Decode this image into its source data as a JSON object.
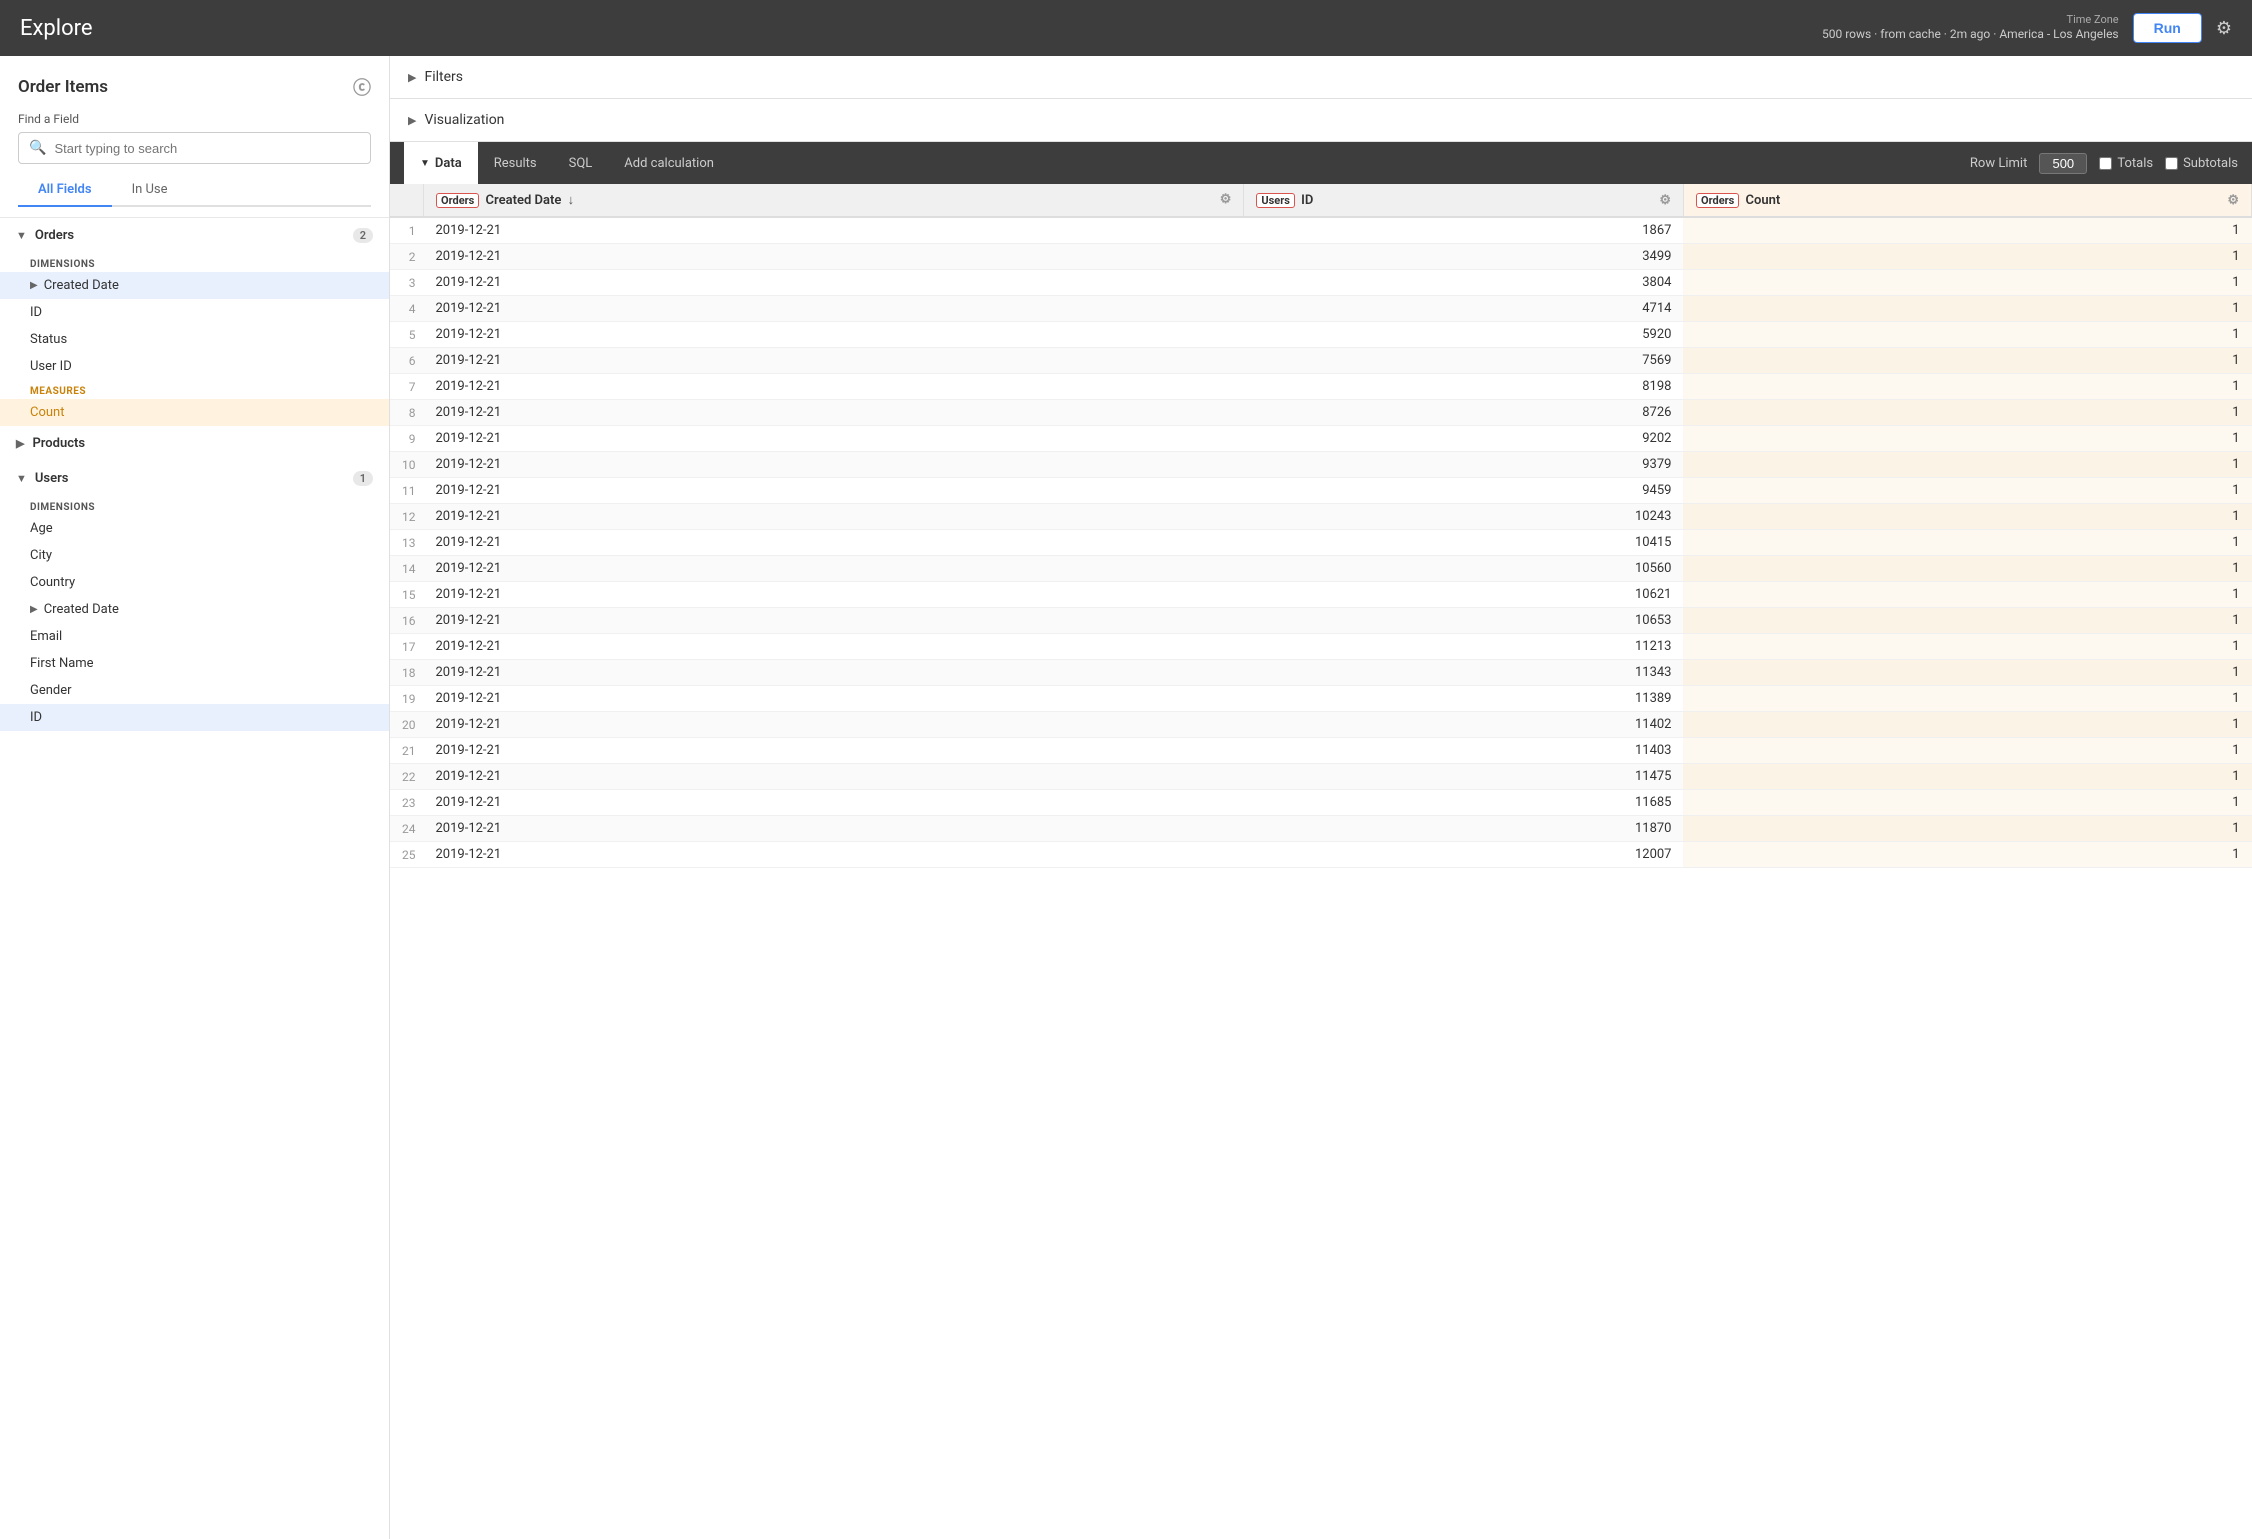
{
  "app": {
    "title": "Explore"
  },
  "topnav": {
    "info_rows": "500 rows · from cache · 2m ago · America - Los Angeles",
    "timezone_label": "Time Zone",
    "run_button": "Run"
  },
  "sidebar": {
    "title": "Order Items",
    "find_field_label": "Find a Field",
    "search_placeholder": "Start typing to search",
    "tabs": [
      {
        "label": "All Fields",
        "active": true
      },
      {
        "label": "In Use",
        "active": false
      }
    ],
    "groups": [
      {
        "name": "Orders",
        "expanded": true,
        "count": 2,
        "sections": [
          {
            "type": "DIMENSIONS",
            "fields": [
              {
                "label": "Created Date",
                "selected": true,
                "hasArrow": true
              },
              {
                "label": "ID",
                "selected": false
              },
              {
                "label": "Status",
                "selected": false
              },
              {
                "label": "User ID",
                "selected": false
              }
            ]
          },
          {
            "type": "MEASURES",
            "fields": [
              {
                "label": "Count",
                "selected": true,
                "measure": true
              }
            ]
          }
        ]
      },
      {
        "name": "Products",
        "expanded": false,
        "count": null,
        "sections": []
      },
      {
        "name": "Users",
        "expanded": true,
        "count": 1,
        "sections": [
          {
            "type": "DIMENSIONS",
            "fields": [
              {
                "label": "Age",
                "selected": false
              },
              {
                "label": "City",
                "selected": false
              },
              {
                "label": "Country",
                "selected": false
              },
              {
                "label": "Created Date",
                "selected": false,
                "hasArrow": true
              },
              {
                "label": "Email",
                "selected": false
              },
              {
                "label": "First Name",
                "selected": false
              },
              {
                "label": "Gender",
                "selected": false
              },
              {
                "label": "ID",
                "selected": true
              }
            ]
          }
        ]
      }
    ]
  },
  "filters": {
    "label": "Filters"
  },
  "visualization": {
    "label": "Visualization"
  },
  "toolbar": {
    "tabs": [
      {
        "label": "Data",
        "active": true,
        "hasArrow": true
      },
      {
        "label": "Results",
        "active": false
      },
      {
        "label": "SQL",
        "active": false
      },
      {
        "label": "Add calculation",
        "active": false
      }
    ],
    "row_limit_label": "Row Limit",
    "row_limit_value": "500",
    "totals_label": "Totals",
    "subtotals_label": "Subtotals"
  },
  "table": {
    "columns": [
      {
        "badge": "Orders",
        "label": "Created Date",
        "sort": "↓",
        "gear": true,
        "type": "dimension"
      },
      {
        "badge": "Users",
        "label": "ID",
        "sort": "",
        "gear": true,
        "type": "dimension"
      },
      {
        "badge": "Orders",
        "label": "Count",
        "sort": "",
        "gear": true,
        "type": "measure"
      }
    ],
    "rows": [
      {
        "num": 1,
        "date": "2019-12-21",
        "user_id": "1867",
        "count": "1"
      },
      {
        "num": 2,
        "date": "2019-12-21",
        "user_id": "3499",
        "count": "1"
      },
      {
        "num": 3,
        "date": "2019-12-21",
        "user_id": "3804",
        "count": "1"
      },
      {
        "num": 4,
        "date": "2019-12-21",
        "user_id": "4714",
        "count": "1"
      },
      {
        "num": 5,
        "date": "2019-12-21",
        "user_id": "5920",
        "count": "1"
      },
      {
        "num": 6,
        "date": "2019-12-21",
        "user_id": "7569",
        "count": "1"
      },
      {
        "num": 7,
        "date": "2019-12-21",
        "user_id": "8198",
        "count": "1"
      },
      {
        "num": 8,
        "date": "2019-12-21",
        "user_id": "8726",
        "count": "1"
      },
      {
        "num": 9,
        "date": "2019-12-21",
        "user_id": "9202",
        "count": "1"
      },
      {
        "num": 10,
        "date": "2019-12-21",
        "user_id": "9379",
        "count": "1"
      },
      {
        "num": 11,
        "date": "2019-12-21",
        "user_id": "9459",
        "count": "1"
      },
      {
        "num": 12,
        "date": "2019-12-21",
        "user_id": "10243",
        "count": "1"
      },
      {
        "num": 13,
        "date": "2019-12-21",
        "user_id": "10415",
        "count": "1"
      },
      {
        "num": 14,
        "date": "2019-12-21",
        "user_id": "10560",
        "count": "1"
      },
      {
        "num": 15,
        "date": "2019-12-21",
        "user_id": "10621",
        "count": "1"
      },
      {
        "num": 16,
        "date": "2019-12-21",
        "user_id": "10653",
        "count": "1"
      },
      {
        "num": 17,
        "date": "2019-12-21",
        "user_id": "11213",
        "count": "1"
      },
      {
        "num": 18,
        "date": "2019-12-21",
        "user_id": "11343",
        "count": "1"
      },
      {
        "num": 19,
        "date": "2019-12-21",
        "user_id": "11389",
        "count": "1"
      },
      {
        "num": 20,
        "date": "2019-12-21",
        "user_id": "11402",
        "count": "1"
      },
      {
        "num": 21,
        "date": "2019-12-21",
        "user_id": "11403",
        "count": "1"
      },
      {
        "num": 22,
        "date": "2019-12-21",
        "user_id": "11475",
        "count": "1"
      },
      {
        "num": 23,
        "date": "2019-12-21",
        "user_id": "11685",
        "count": "1"
      },
      {
        "num": 24,
        "date": "2019-12-21",
        "user_id": "11870",
        "count": "1"
      },
      {
        "num": 25,
        "date": "2019-12-21",
        "user_id": "12007",
        "count": "1"
      }
    ]
  }
}
